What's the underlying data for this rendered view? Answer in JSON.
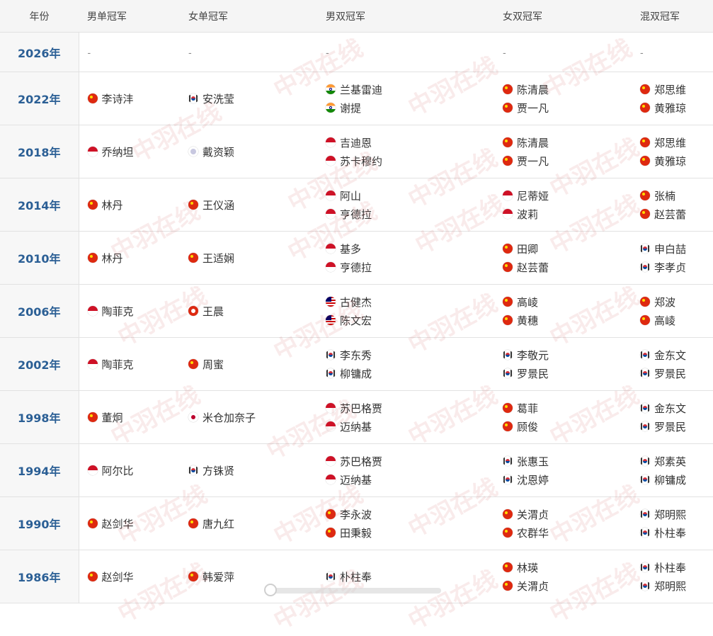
{
  "table": {
    "headers": [
      "年份",
      "男单冠军",
      "女单冠军",
      "男双冠军",
      "女双冠军",
      "混双冠军"
    ],
    "rows": [
      {
        "year": "2026年",
        "ms": [],
        "ws": [],
        "md": [],
        "wd": [],
        "xd": []
      },
      {
        "year": "2022年",
        "ms": [
          {
            "name": "李诗沣",
            "flag": "china"
          }
        ],
        "ws": [
          {
            "name": "安洗莹",
            "flag": "korea"
          }
        ],
        "md": [
          {
            "name": "兰基雷迪",
            "flag": "india"
          },
          {
            "name": "谢提",
            "flag": "india"
          }
        ],
        "wd": [
          {
            "name": "陈清晨",
            "flag": "china"
          },
          {
            "name": "贾一凡",
            "flag": "china"
          }
        ],
        "xd": [
          {
            "name": "郑思维",
            "flag": "china"
          },
          {
            "name": "黄雅琼",
            "flag": "china"
          }
        ]
      },
      {
        "year": "2018年",
        "ms": [
          {
            "name": "乔纳坦",
            "flag": "indonesia"
          }
        ],
        "ws": [
          {
            "name": "戴资颖",
            "flag": "taipei"
          }
        ],
        "md": [
          {
            "name": "吉迪恩",
            "flag": "indonesia"
          },
          {
            "name": "苏卡穆约",
            "flag": "indonesia"
          }
        ],
        "wd": [
          {
            "name": "陈清晨",
            "flag": "china"
          },
          {
            "name": "贾一凡",
            "flag": "china"
          }
        ],
        "xd": [
          {
            "name": "郑思维",
            "flag": "china"
          },
          {
            "name": "黄雅琼",
            "flag": "china"
          }
        ]
      },
      {
        "year": "2014年",
        "ms": [
          {
            "name": "林丹",
            "flag": "china"
          }
        ],
        "ws": [
          {
            "name": "王仪涵",
            "flag": "china"
          }
        ],
        "md": [
          {
            "name": "阿山",
            "flag": "indonesia"
          },
          {
            "name": "亨德拉",
            "flag": "indonesia"
          }
        ],
        "wd": [
          {
            "name": "尼蒂娅",
            "flag": "indonesia"
          },
          {
            "name": "波莉",
            "flag": "indonesia"
          }
        ],
        "xd": [
          {
            "name": "张楠",
            "flag": "china"
          },
          {
            "name": "赵芸蕾",
            "flag": "china"
          }
        ]
      },
      {
        "year": "2010年",
        "ms": [
          {
            "name": "林丹",
            "flag": "china"
          }
        ],
        "ws": [
          {
            "name": "王适娴",
            "flag": "china"
          }
        ],
        "md": [
          {
            "name": "基多",
            "flag": "indonesia"
          },
          {
            "name": "亨德拉",
            "flag": "indonesia"
          }
        ],
        "wd": [
          {
            "name": "田卿",
            "flag": "china"
          },
          {
            "name": "赵芸蕾",
            "flag": "china"
          }
        ],
        "xd": [
          {
            "name": "申白喆",
            "flag": "korea"
          },
          {
            "name": "李孝贞",
            "flag": "korea"
          }
        ]
      },
      {
        "year": "2006年",
        "ms": [
          {
            "name": "陶菲克",
            "flag": "indonesia"
          }
        ],
        "ws": [
          {
            "name": "王晨",
            "flag": "hongkong"
          }
        ],
        "md": [
          {
            "name": "古健杰",
            "flag": "malaysia"
          },
          {
            "name": "陈文宏",
            "flag": "malaysia"
          }
        ],
        "wd": [
          {
            "name": "高崚",
            "flag": "china"
          },
          {
            "name": "黄穗",
            "flag": "china"
          }
        ],
        "xd": [
          {
            "name": "郑波",
            "flag": "china"
          },
          {
            "name": "高崚",
            "flag": "china"
          }
        ]
      },
      {
        "year": "2002年",
        "ms": [
          {
            "name": "陶菲克",
            "flag": "indonesia"
          }
        ],
        "ws": [
          {
            "name": "周蜜",
            "flag": "china"
          }
        ],
        "md": [
          {
            "name": "李东秀",
            "flag": "korea"
          },
          {
            "name": "柳镛成",
            "flag": "korea"
          }
        ],
        "wd": [
          {
            "name": "李敬元",
            "flag": "korea"
          },
          {
            "name": "罗景民",
            "flag": "korea"
          }
        ],
        "xd": [
          {
            "name": "金东文",
            "flag": "korea"
          },
          {
            "name": "罗景民",
            "flag": "korea"
          }
        ]
      },
      {
        "year": "1998年",
        "ms": [
          {
            "name": "董炯",
            "flag": "china"
          }
        ],
        "ws": [
          {
            "name": "米仓加奈子",
            "flag": "japan"
          }
        ],
        "md": [
          {
            "name": "苏巴格贾",
            "flag": "indonesia"
          },
          {
            "name": "迈纳基",
            "flag": "indonesia"
          }
        ],
        "wd": [
          {
            "name": "葛菲",
            "flag": "china"
          },
          {
            "name": "顾俊",
            "flag": "china"
          }
        ],
        "xd": [
          {
            "name": "金东文",
            "flag": "korea"
          },
          {
            "name": "罗景民",
            "flag": "korea"
          }
        ]
      },
      {
        "year": "1994年",
        "ms": [
          {
            "name": "阿尔比",
            "flag": "indonesia"
          }
        ],
        "ws": [
          {
            "name": "方铢贤",
            "flag": "korea"
          }
        ],
        "md": [
          {
            "name": "苏巴格贾",
            "flag": "indonesia"
          },
          {
            "name": "迈纳基",
            "flag": "indonesia"
          }
        ],
        "wd": [
          {
            "name": "张惠玉",
            "flag": "korea"
          },
          {
            "name": "沈恩婷",
            "flag": "korea"
          }
        ],
        "xd": [
          {
            "name": "郑素英",
            "flag": "korea"
          },
          {
            "name": "柳镛成",
            "flag": "korea"
          }
        ]
      },
      {
        "year": "1990年",
        "ms": [
          {
            "name": "赵剑华",
            "flag": "china"
          }
        ],
        "ws": [
          {
            "name": "唐九红",
            "flag": "china"
          }
        ],
        "md": [
          {
            "name": "李永波",
            "flag": "china"
          },
          {
            "name": "田秉毅",
            "flag": "china"
          }
        ],
        "wd": [
          {
            "name": "关渭贞",
            "flag": "china"
          },
          {
            "name": "农群华",
            "flag": "china"
          }
        ],
        "xd": [
          {
            "name": "郑明熙",
            "flag": "korea"
          },
          {
            "name": "朴柱奉",
            "flag": "korea"
          }
        ]
      },
      {
        "year": "1986年",
        "ms": [
          {
            "name": "赵剑华",
            "flag": "china"
          }
        ],
        "ws": [
          {
            "name": "韩爱萍",
            "flag": "china"
          }
        ],
        "md": [
          {
            "name": "朴柱奉",
            "flag": "korea"
          }
        ],
        "wd": [
          {
            "name": "林瑛",
            "flag": "china"
          },
          {
            "name": "关渭贞",
            "flag": "china"
          }
        ],
        "xd": [
          {
            "name": "朴柱奉",
            "flag": "korea"
          },
          {
            "name": "郑明熙",
            "flag": "korea"
          }
        ]
      }
    ]
  },
  "empty_marker": "-",
  "watermark": {
    "text": "中羽在线"
  }
}
